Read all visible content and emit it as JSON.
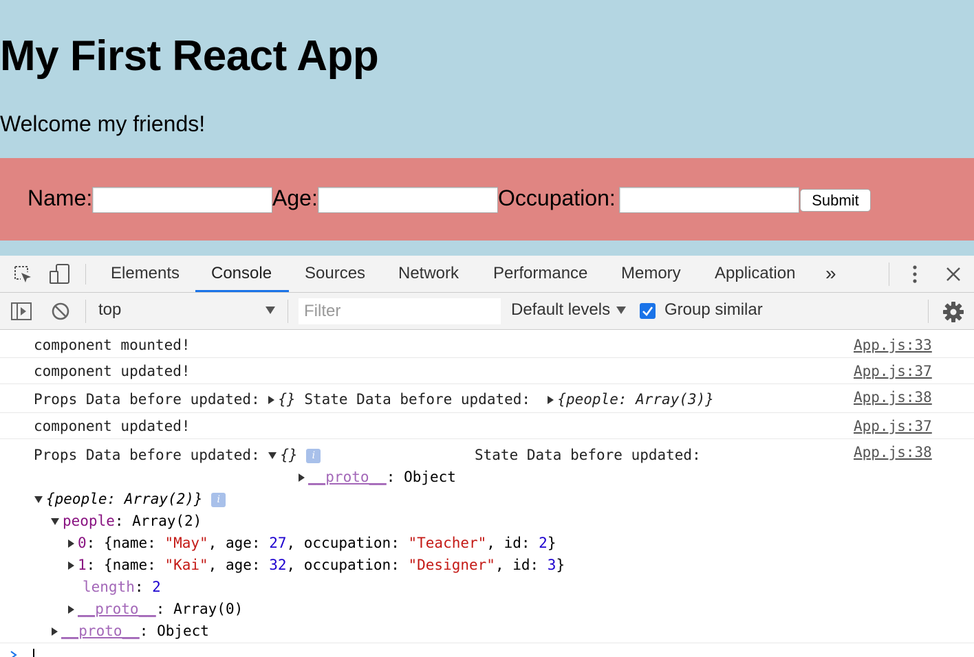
{
  "app": {
    "title": "My First React App",
    "subtitle": "Welcome my friends!",
    "form": {
      "name_label": "Name:",
      "age_label": "Age:",
      "occupation_label": "Occupation:",
      "name_value": "",
      "age_value": "",
      "occupation_value": "",
      "submit_label": "Submit"
    },
    "colors": {
      "header_bg": "#b4d6e2",
      "form_bg": "#e08582"
    }
  },
  "devtools": {
    "tabs": [
      {
        "label": "Elements",
        "active": false
      },
      {
        "label": "Console",
        "active": true
      },
      {
        "label": "Sources",
        "active": false
      },
      {
        "label": "Network",
        "active": false
      },
      {
        "label": "Performance",
        "active": false
      },
      {
        "label": "Memory",
        "active": false
      },
      {
        "label": "Application",
        "active": false
      }
    ],
    "more_tabs_label": "»",
    "context_value": "top",
    "filter_placeholder": "Filter",
    "levels_label": "Default levels",
    "group_similar_label": "Group similar",
    "group_similar_checked": true,
    "accent_color": "#1a73e8"
  },
  "console": {
    "messages": [
      {
        "text": "component mounted!",
        "source": "App.js:33"
      },
      {
        "text": "component updated!",
        "source": "App.js:37"
      },
      {
        "text_props": "Props Data before updated: ",
        "props_obj": "{}",
        "text_state": " State Data before updated: ",
        "state_obj": "{people: Array(3)}",
        "source": "App.js:38"
      },
      {
        "text": "component updated!",
        "source": "App.js:37"
      },
      {
        "text_props": "Props Data before updated: ",
        "props_obj": "{}",
        "text_state": "State Data before updated:",
        "source": "App.js:38"
      }
    ],
    "expanded": {
      "props_proto": "__proto__",
      "props_proto_value": ": Object",
      "state_summary": "{people: Array(2)}",
      "people_key": "people",
      "people_value": ": Array(2)",
      "items": [
        {
          "index": "0",
          "name": "\"May\"",
          "age": "27",
          "occupation": "\"Teacher\"",
          "id": "2"
        },
        {
          "index": "1",
          "name": "\"Kai\"",
          "age": "32",
          "occupation": "\"Designer\"",
          "id": "3"
        }
      ],
      "length_key": "length",
      "length_value": "2",
      "array_proto": "__proto__",
      "array_proto_value": ": Array(0)",
      "obj_proto": "__proto__",
      "obj_proto_value": ": Object"
    },
    "info_glyph": "i"
  }
}
